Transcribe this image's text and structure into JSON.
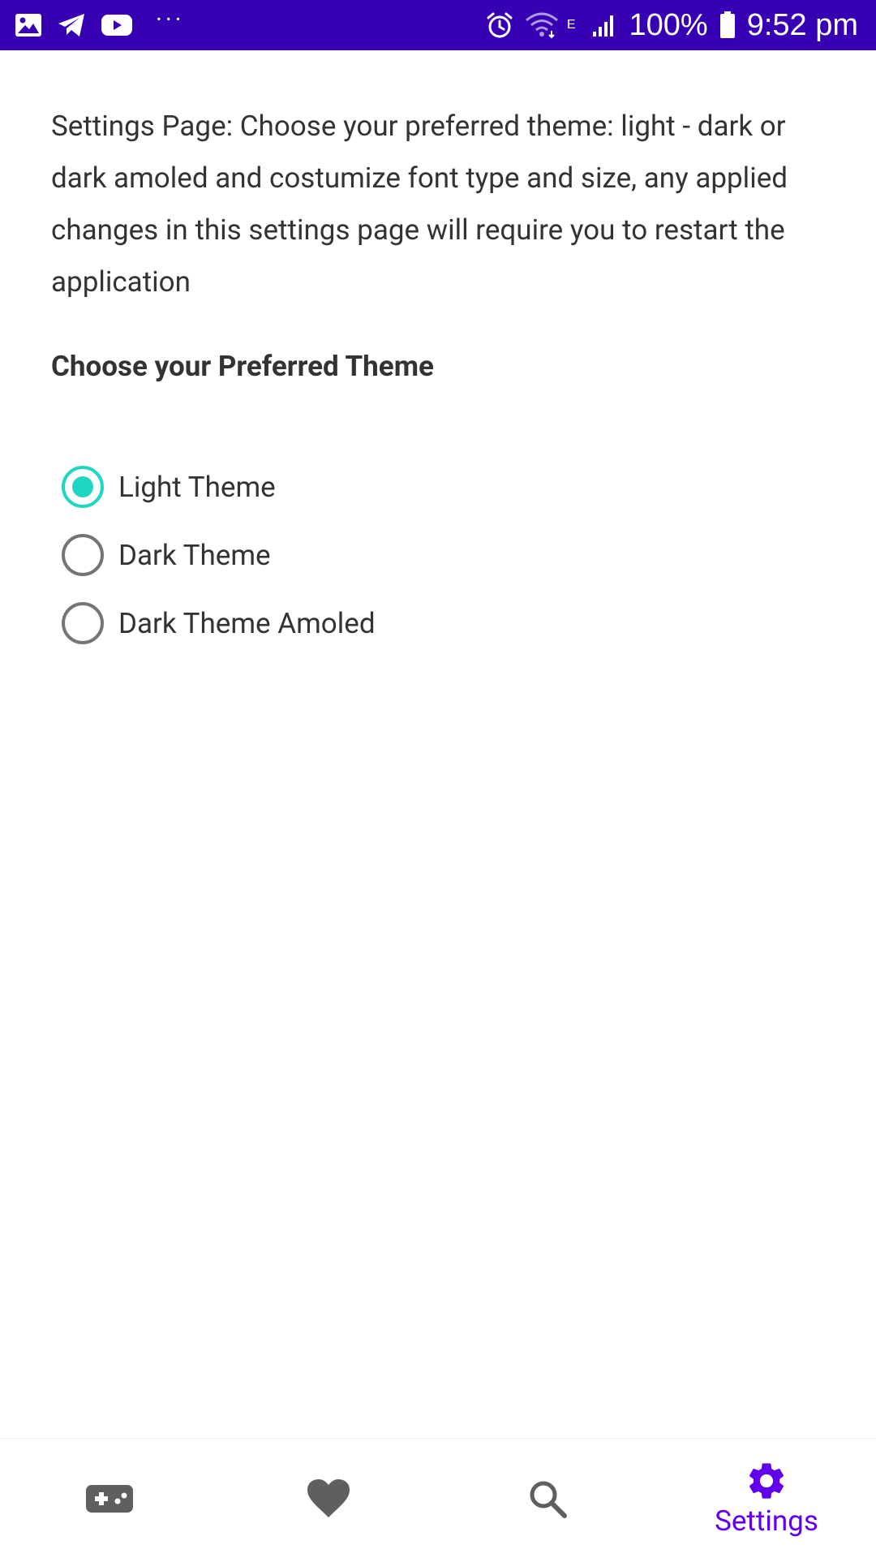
{
  "colors": {
    "status_bar": "#3700b3",
    "accent": "#1fd6c2",
    "primary": "#6200ee",
    "inactive_icon": "#5f5f5f",
    "text": "#333333"
  },
  "status_bar": {
    "left_icons": [
      "gallery-icon",
      "telegram-icon",
      "youtube-icon"
    ],
    "more": "···",
    "network_type": "E",
    "battery_percent": "100%",
    "time": "9:52 pm"
  },
  "main": {
    "description": "Settings Page: Choose your preferred theme: light - dark or dark amoled and costumize font type and size, any applied changes in this settings page will require you to restart the application",
    "theme_section_title": "Choose your Preferred Theme",
    "theme_options": [
      {
        "label": "Light Theme",
        "checked": true
      },
      {
        "label": "Dark Theme",
        "checked": false
      },
      {
        "label": "Dark Theme Amoled",
        "checked": false
      }
    ]
  },
  "bottom_nav": {
    "items": [
      {
        "icon": "gamepad-icon",
        "label": "",
        "active": false
      },
      {
        "icon": "heart-icon",
        "label": "",
        "active": false
      },
      {
        "icon": "search-icon",
        "label": "",
        "active": false
      },
      {
        "icon": "settings-gear-icon",
        "label": "Settings",
        "active": true
      }
    ]
  }
}
